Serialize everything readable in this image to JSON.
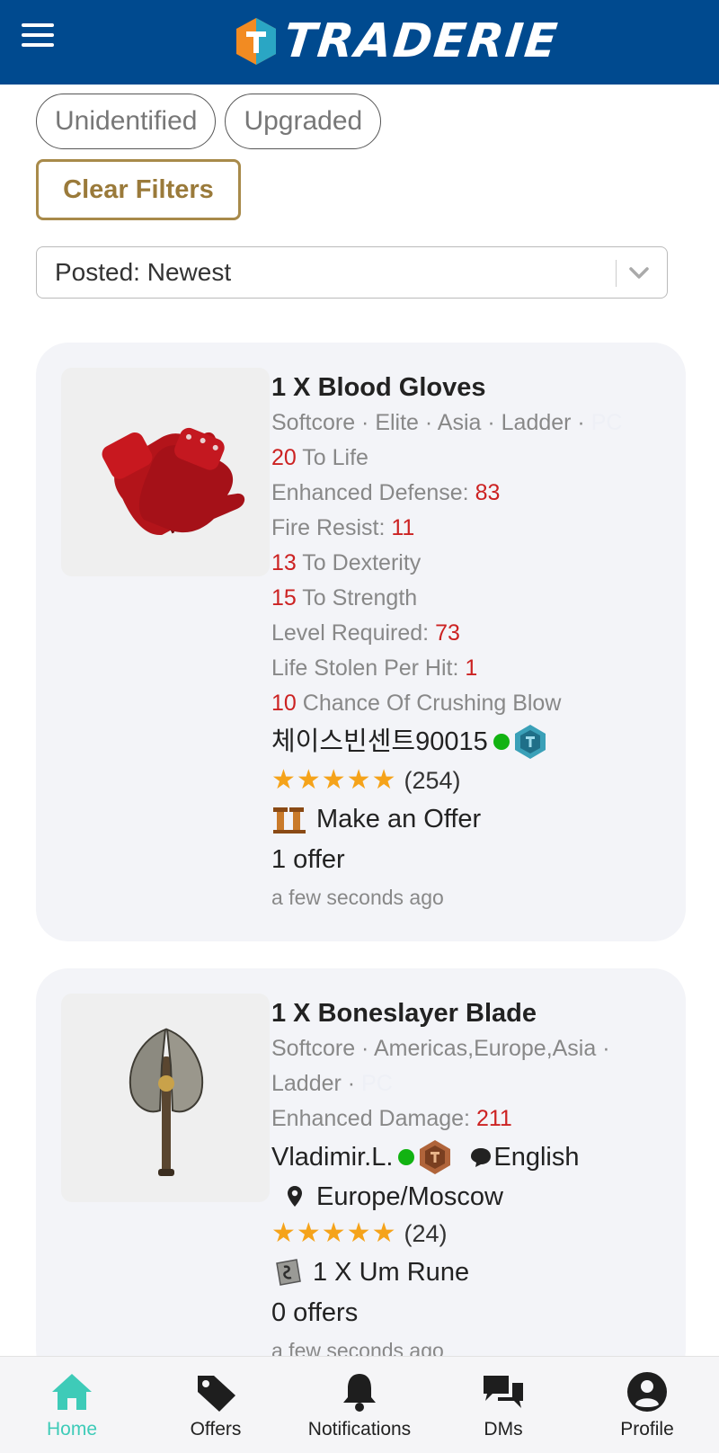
{
  "app": {
    "name": "TRADERIE",
    "brand_color": "#004a8f",
    "accent_color": "#3ecbb8"
  },
  "filters": {
    "chips": [
      "Unidentified",
      "Upgraded"
    ],
    "clear_label": "Clear Filters",
    "sort_value": "Posted: Newest"
  },
  "listings": [
    {
      "title": "1 X Blood Gloves",
      "meta": "Softcore · Elite · Asia · Ladder ·",
      "platform": "PC",
      "stats": [
        {
          "prefix": "20",
          "label": " To Life",
          "suffix": ""
        },
        {
          "prefix": "",
          "label": "Enhanced Defense: ",
          "suffix": "83"
        },
        {
          "prefix": "",
          "label": "Fire Resist: ",
          "suffix": "11"
        },
        {
          "prefix": "13",
          "label": " To Dexterity",
          "suffix": ""
        },
        {
          "prefix": "15",
          "label": " To Strength",
          "suffix": ""
        },
        {
          "prefix": "",
          "label": "Level Required: ",
          "suffix": "73"
        },
        {
          "prefix": "",
          "label": "Life Stolen Per Hit: ",
          "suffix": "1"
        },
        {
          "prefix": "10",
          "label": " Chance Of Crushing Blow",
          "suffix": ""
        }
      ],
      "seller": "체이스빈센트90015",
      "rating_stars": 5,
      "rating_count": "(254)",
      "offer_label": "Make an Offer",
      "offers": "1 offer",
      "time": "a few seconds ago"
    },
    {
      "title": "1 X Boneslayer Blade",
      "meta_line1": "Softcore · Americas,Europe,Asia ·",
      "meta_line2": "Ladder ·",
      "platform": "PC",
      "stats": [
        {
          "prefix": "",
          "label": "Enhanced Damage: ",
          "suffix": "211"
        }
      ],
      "seller": "Vladimir.L.",
      "language": "English",
      "location": "Europe/Moscow",
      "rating_stars": 5,
      "rating_count": "(24)",
      "offer_label": "1 X Um Rune",
      "offers": "0 offers",
      "time": "a few seconds ago"
    }
  ],
  "nav": [
    {
      "label": "Home",
      "icon": "home-icon",
      "active": true
    },
    {
      "label": "Offers",
      "icon": "tag-icon",
      "active": false
    },
    {
      "label": "Notifications",
      "icon": "bell-icon",
      "active": false
    },
    {
      "label": "DMs",
      "icon": "chat-icon",
      "active": false
    },
    {
      "label": "Profile",
      "icon": "user-icon",
      "active": false
    }
  ]
}
